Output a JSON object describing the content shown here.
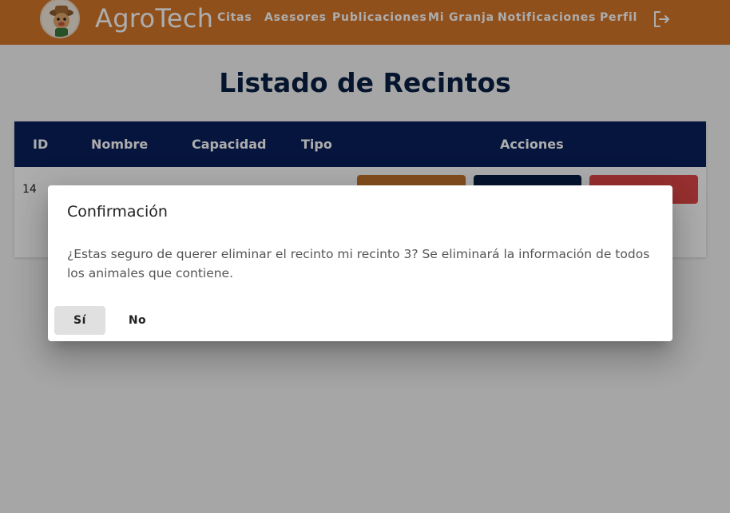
{
  "header": {
    "brand": "AgroTech",
    "nav": [
      "Citas",
      "Asesores",
      "Publicaciones",
      "Mi Granja",
      "Notificaciones",
      "Perfil"
    ],
    "logout_icon": "logout-icon",
    "bg_color": "#d4762a"
  },
  "page": {
    "title": "Listado de Recintos",
    "table": {
      "columns": [
        "ID",
        "Nombre",
        "Capacidad",
        "Tipo",
        "Acciones"
      ],
      "rows": [
        {
          "id": "14"
        }
      ],
      "header_color": "#0a1f5c"
    }
  },
  "dialog": {
    "title": "Confirmación",
    "message": "¿Estas seguro de querer eliminar el recinto mi recinto 3? Se eliminará la información de todos los animales que contiene.",
    "confirm_label": "Sí",
    "cancel_label": "No"
  }
}
